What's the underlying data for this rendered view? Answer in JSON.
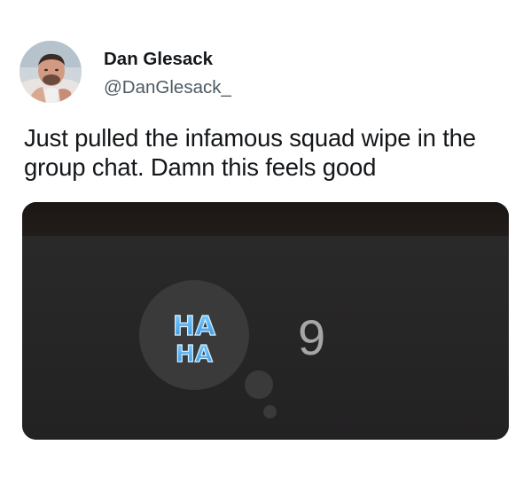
{
  "tweet": {
    "author": {
      "display_name": "Dan Glesack",
      "handle": "@DanGlesack_"
    },
    "text": "Just pulled the infamous squad wipe in the group chat. Damn this feels good",
    "media": {
      "reaction": {
        "icon": "haha-icon",
        "label_line1": "HA",
        "label_line2": "HA",
        "count": "9"
      }
    }
  },
  "colors": {
    "text_primary": "#14171a",
    "text_secondary": "#4e5a63",
    "media_background": "#232223",
    "bubble": "#3b3a3b",
    "haha_blue": "#36a8f0",
    "count_gray": "#a7a6a7"
  }
}
